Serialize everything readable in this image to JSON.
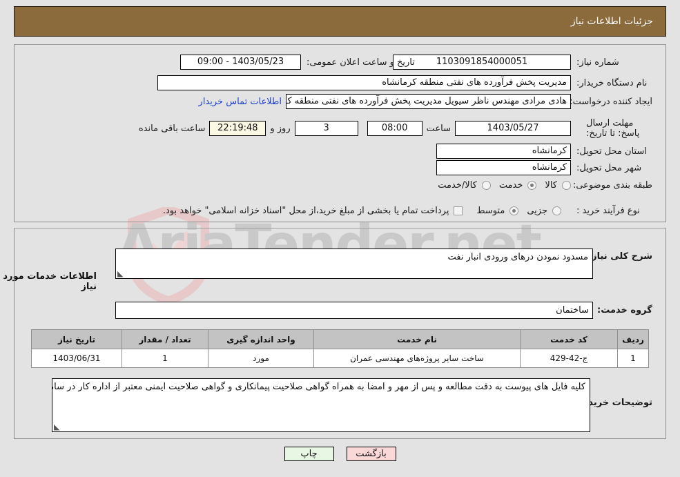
{
  "header": {
    "title": "جزئیات اطلاعات نیاز",
    "bar_color": "#8b6a3c"
  },
  "watermark": {
    "text": "AriaTender.net"
  },
  "form": {
    "need_number": {
      "label": "شماره نیاز:",
      "value": "1103091854000051"
    },
    "announce_datetime": {
      "label": "تاریخ و ساعت اعلان عمومی:",
      "value": "1403/05/23 - 09:00"
    },
    "buyer_org": {
      "label": "نام دستگاه خریدار:",
      "value": "مدیریت پخش فرآورده های نفتی منطقه کرمانشاه"
    },
    "request_creator": {
      "label": "ایجاد کننده درخواست:",
      "value": "هادی مرادی مهندس ناظر سیویل مدیریت پخش فرآورده های نفتی منطقه کرمانشاه"
    },
    "contact_link": {
      "label": "اطلاعات تماس خریدار"
    },
    "deadline": {
      "label": "مهلت ارسال پاسخ: تا تاریخ:",
      "date": "1403/05/27",
      "time_label": "ساعت",
      "time": "08:00",
      "days": "3",
      "days_label": "روز و",
      "countdown": "22:19:48",
      "remaining_label": "ساعت باقی مانده"
    },
    "delivery_province": {
      "label": "استان محل تحویل:",
      "value": "کرمانشاه"
    },
    "delivery_city": {
      "label": "شهر محل تحویل:",
      "value": "کرمانشاه"
    },
    "category": {
      "label": "طبقه بندی موضوعی:",
      "options": [
        {
          "label": "کالا",
          "selected": false
        },
        {
          "label": "خدمت",
          "selected": true
        },
        {
          "label": "کالا/خدمت",
          "selected": false
        }
      ]
    },
    "purchase_process": {
      "label": "نوع فرآیند خرید :",
      "options": [
        {
          "label": "جزیی",
          "selected": false
        },
        {
          "label": "متوسط",
          "selected": true
        }
      ],
      "checkbox_label": "پرداخت تمام یا بخشی از مبلغ خرید،از محل \"اسناد خزانه اسلامی\" خواهد بود.",
      "checkbox_checked": false
    },
    "general_description": {
      "label": "شرح کلی نیاز:",
      "value": "مسدود نمودن درهای ورودی انبار نفت"
    },
    "services_section_title": "اطلاعات خدمات مورد نیاز",
    "service_group": {
      "label": "گروه خدمت:",
      "value": "ساختمان"
    },
    "buyer_notes": {
      "label": "توضیحات خریدار:",
      "value": "کلیه فایل های پیوست به دقت مطالعه و پس از مهر و امضا به همراه گواهی صلاحیت پیمانکاری و گواهی صلاحیت ایمنی معتبر از اداره کار در سامانه بارگذاری گردد."
    }
  },
  "table": {
    "columns": [
      "ردیف",
      "کد خدمت",
      "نام خدمت",
      "واحد اندازه گیری",
      "تعداد / مقدار",
      "تاریخ نیاز"
    ],
    "rows": [
      {
        "index": "1",
        "code": "ج-42-429",
        "name": "ساخت سایر پروژه‌های مهندسی عمران",
        "unit": "مورد",
        "quantity": "1",
        "need_date": "1403/06/31"
      }
    ]
  },
  "buttons": {
    "print": "چاپ",
    "back": "بازگشت"
  }
}
